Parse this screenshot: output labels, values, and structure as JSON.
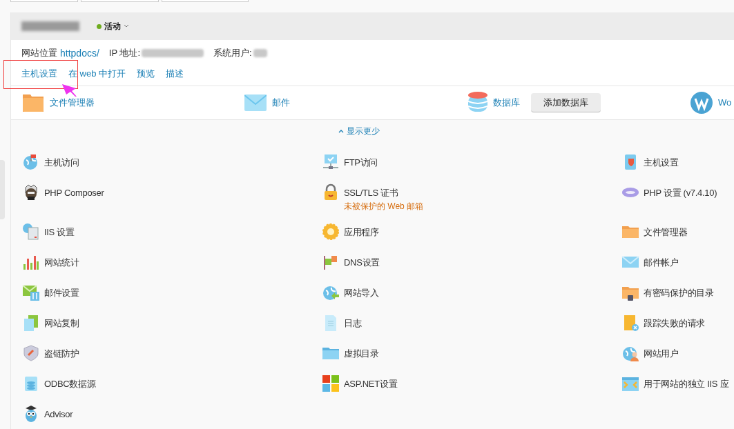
{
  "header": {
    "status": "活动"
  },
  "info": {
    "location_label": "网站位置",
    "location_link": "httpdocs/",
    "ip_label": "IP 地址:",
    "user_label": "系统用户:"
  },
  "actions": [
    "主机设置",
    "在 web 中打开",
    "预览",
    "描述"
  ],
  "quick_access": [
    {
      "kind": "link",
      "label": "文件管理器"
    },
    {
      "kind": "link",
      "label": "邮件"
    },
    {
      "kind": "link_button",
      "label": "数据库",
      "button": "添加数据库"
    },
    {
      "kind": "link",
      "label": "Wo"
    }
  ],
  "toggle": "显示更少",
  "tools": [
    {
      "label": "主机访问"
    },
    {
      "label": "FTP访问"
    },
    {
      "label": "主机设置"
    },
    {
      "label": "PHP Composer"
    },
    {
      "label": "SSL/TLS 证书",
      "warning": "未被保护的 Web 邮箱"
    },
    {
      "label": "PHP 设置 (v7.4.10)"
    },
    {
      "label": "IIS 设置"
    },
    {
      "label": "应用程序"
    },
    {
      "label": "文件管理器"
    },
    {
      "label": "网站统计"
    },
    {
      "label": "DNS设置"
    },
    {
      "label": "邮件帐户"
    },
    {
      "label": "邮件设置"
    },
    {
      "label": "网站导入"
    },
    {
      "label": "有密码保护的目录"
    },
    {
      "label": "网站复制"
    },
    {
      "label": "日志"
    },
    {
      "label": "跟踪失败的请求"
    },
    {
      "label": "盗链防护"
    },
    {
      "label": "虚拟目录"
    },
    {
      "label": "网站用户"
    },
    {
      "label": "ODBC数据源"
    },
    {
      "label": "ASP.NET设置"
    },
    {
      "label": "用于网站的独立 IIS 应"
    },
    {
      "label": "Advisor"
    }
  ]
}
